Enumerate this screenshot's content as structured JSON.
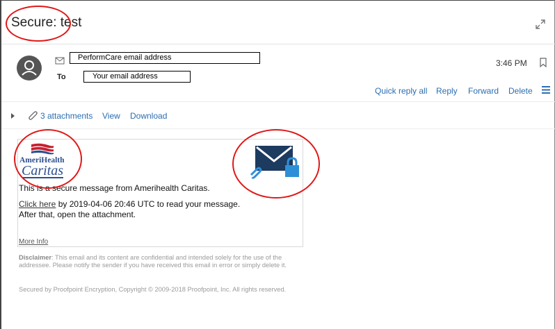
{
  "message": {
    "subject": "Secure: test",
    "from_redacted": "PerformCare email address",
    "to_label": "To",
    "to_redacted": "Your email address",
    "time": "3:46 PM"
  },
  "actions": {
    "quick_reply_all": "Quick reply all",
    "reply": "Reply",
    "forward": "Forward",
    "delete": "Delete"
  },
  "attachments": {
    "count_label": "3 attachments",
    "view": "View",
    "download": "Download"
  },
  "body": {
    "logo_line1": "AmeriHealth",
    "logo_line2": "Caritas",
    "line1": "This is a secure message from Amerihealth Caritas.",
    "click_here": "Click here",
    "line2_rest": " by 2019-04-06 20:46 UTC to read your message.",
    "line3": "After that, open the attachment.",
    "more_info": "More Info"
  },
  "footer": {
    "disclaimer_label": "Disclaimer",
    "disclaimer_text": ": This email and its content are confidential and intended solely for the use of the addressee. Please notify the sender if you have received this email in error or simply delete it.",
    "secured": "Secured by Proofpoint Encryption, Copyright © 2009-2018 Proofpoint, Inc. All rights reserved."
  },
  "colors": {
    "link_blue": "#2b6db1",
    "annotation_red": "#e01818",
    "lock_blue": "#2f8fd6",
    "envelope_navy": "#1d3a5f"
  },
  "icons": [
    "expand-icon",
    "avatar-icon",
    "envelope-icon",
    "bookmark-icon",
    "menu-icon",
    "paperclip-icon",
    "secure-envelope-lock-icon"
  ]
}
